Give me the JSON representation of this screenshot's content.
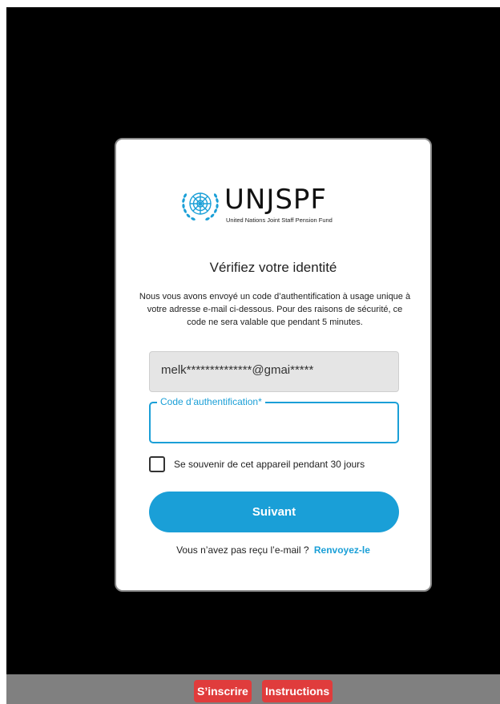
{
  "colors": {
    "accent": "#1a9fd7",
    "background": "#000000",
    "card": "#ffffff",
    "footer_bar": "#808080",
    "footer_button": "#e03c3c"
  },
  "logo": {
    "icon": "un-emblem-icon",
    "name": "UNJSPF",
    "subtitle": "United Nations Joint Staff Pension Fund"
  },
  "form": {
    "title": "Vérifiez votre identité",
    "description": "Nous vous avons envoyé un code d’authentification à usage unique à votre adresse e-mail ci-dessous. Pour des raisons de sécurité, ce code ne sera valable que pendant 5 minutes.",
    "email_value": "melk**************@gmai*****",
    "code_label": "Code d’authentification*",
    "code_value": "",
    "remember_label": "Se souvenir de cet appareil pendant 30 jours",
    "remember_checked": false,
    "next_label": "Suivant",
    "resend_prompt": "Vous n’avez pas reçu l’e-mail ?",
    "resend_link": "Renvoyez-le"
  },
  "footer": {
    "signup_label": "S’inscrire",
    "instructions_label": "Instructions"
  }
}
